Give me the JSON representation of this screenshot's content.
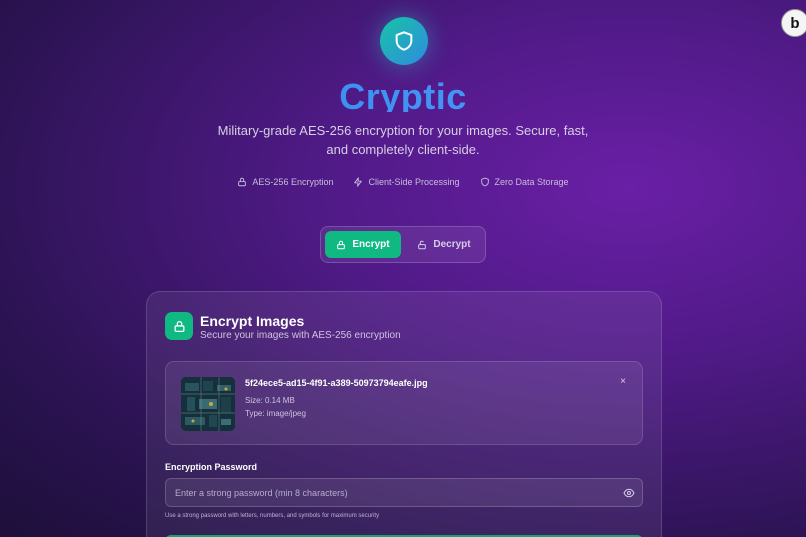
{
  "header": {
    "logo_icon": "shield-icon",
    "brand_name": "Cryptic",
    "tagline": "Military-grade AES-256 encryption for your images. Secure, fast, and completely client-side."
  },
  "features": [
    {
      "icon": "lock-icon",
      "label": "AES-256 Encryption"
    },
    {
      "icon": "lightning-icon",
      "label": "Client-Side Processing"
    },
    {
      "icon": "shield-icon",
      "label": "Zero Data Storage"
    }
  ],
  "mode_toggle": {
    "encrypt_label": "Encrypt",
    "decrypt_label": "Decrypt",
    "active": "Encrypt"
  },
  "card": {
    "title": "Encrypt Images",
    "subtitle": "Secure your images with AES-256 encryption",
    "file": {
      "name": "5f24ece5-ad15-4f91-a389-50973794eafe.jpg",
      "size": "Size: 0.14 MB",
      "type": "Type: image/jpeg",
      "remove_label": "×"
    },
    "password": {
      "label": "Encryption Password",
      "placeholder": "Enter a strong password (min 8 characters)",
      "value": "",
      "hint": "Use a strong password with letters, numbers, and symbols for maximum security"
    }
  },
  "corner_badge": {
    "letter": "b"
  },
  "colors": {
    "accent": "#10b981",
    "brand": "#3f8df0",
    "background": "#4f1a86"
  }
}
